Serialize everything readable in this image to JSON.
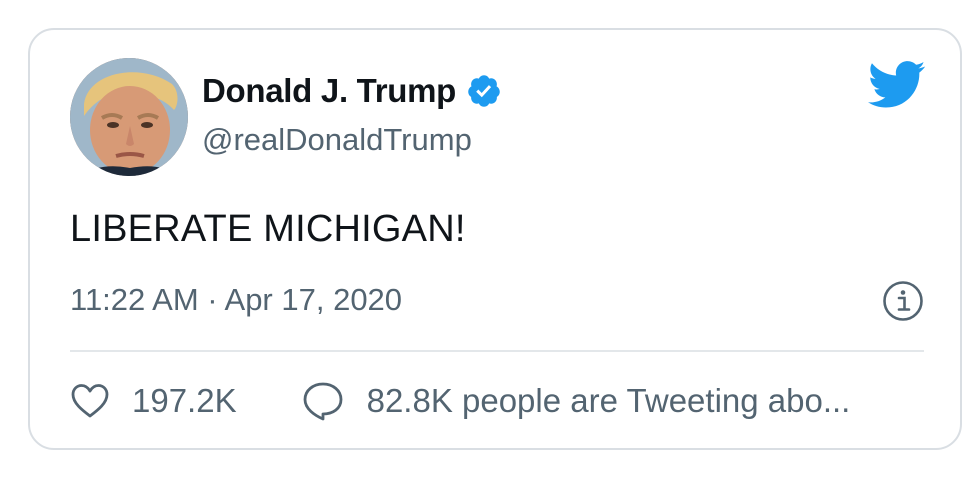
{
  "author": {
    "name": "Donald J. Trump",
    "handle": "@realDonaldTrump",
    "verified_icon": "verified-badge-icon",
    "verified_color": "#1d9bf0"
  },
  "brand": {
    "icon": "twitter-bird-icon",
    "color": "#1d9bf0"
  },
  "tweet": {
    "text": "LIBERATE MICHIGAN!",
    "timestamp": "11:22 AM · Apr 17, 2020"
  },
  "info_icon": "info-icon",
  "actions": {
    "likes": "197.2K",
    "conversation": "82.8K people are Tweeting abo..."
  }
}
